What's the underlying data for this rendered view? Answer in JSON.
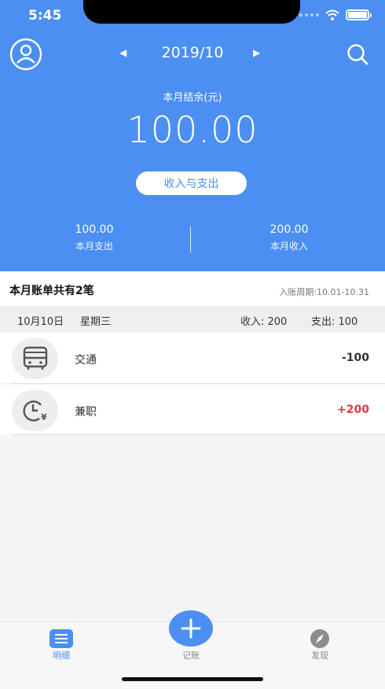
{
  "status": {
    "time": "5:45"
  },
  "header": {
    "month": "2019/10",
    "balance_label": "本月结余(元)",
    "balance_value": "100.00",
    "io_button": "收入与支出",
    "expense_value": "100.00",
    "expense_label": "本月支出",
    "income_value": "200.00",
    "income_label": "本月收入"
  },
  "bills": {
    "count_text": "本月账单共有2笔",
    "period_text": "入账周期:10.01-10.31"
  },
  "day": {
    "date": "10月10日",
    "weekday": "星期三",
    "income": "收入: 200",
    "expense": "支出: 100"
  },
  "entries": [
    {
      "name": "交通",
      "amount": "-100",
      "icon": "bus-icon"
    },
    {
      "name": "兼职",
      "amount": "+200",
      "icon": "clock-yen-icon"
    }
  ],
  "tabbar": {
    "detail": "明细",
    "record": "记账",
    "discover": "发现"
  },
  "colors": {
    "brand": "#4b8ff2",
    "positive": "#e03a3a"
  }
}
